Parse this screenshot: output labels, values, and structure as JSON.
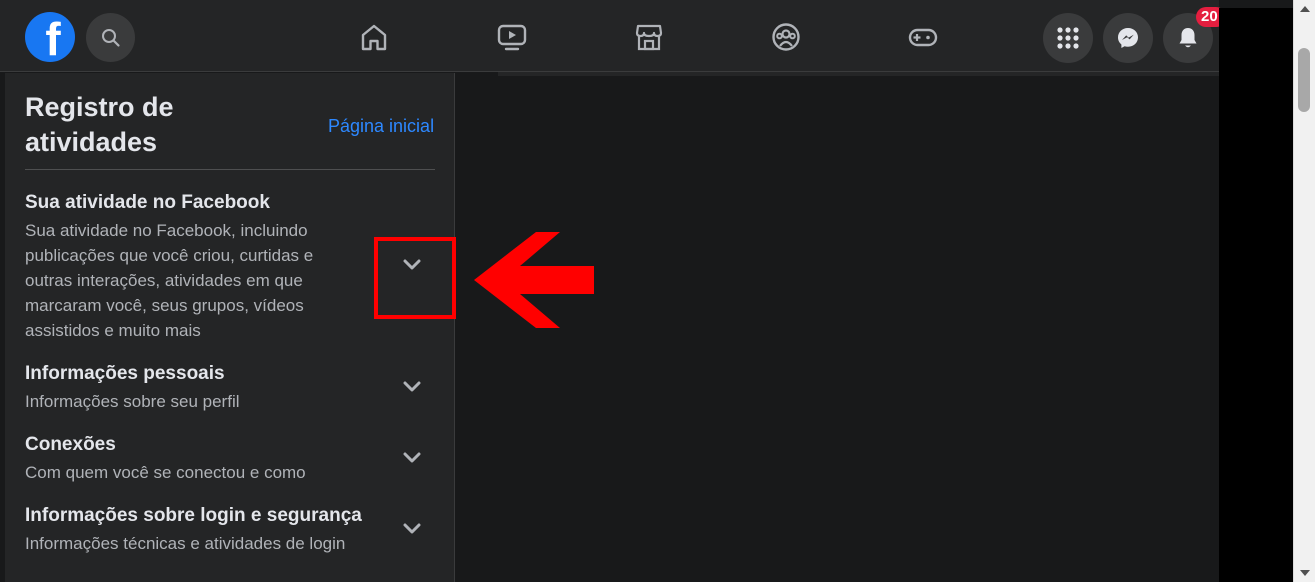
{
  "topbar": {
    "logo_letter": "f",
    "notification_count": "20",
    "icons": {
      "search": "search-icon",
      "home": "home-icon",
      "watch": "video-icon",
      "marketplace": "marketplace-icon",
      "groups": "groups-icon",
      "gaming": "gaming-icon",
      "menu": "grid-menu-icon",
      "messenger": "messenger-icon",
      "notifications": "bell-icon"
    }
  },
  "sidebar": {
    "title": "Registro de atividades",
    "home_link": "Página inicial",
    "items": [
      {
        "heading": "Sua atividade no Facebook",
        "description": "Sua atividade no Facebook, incluindo publicações que você criou, curtidas e outras interações, atividades em que marcaram você, seus grupos, vídeos assistidos e muito mais"
      },
      {
        "heading": "Informações pessoais",
        "description": "Informações sobre seu perfil"
      },
      {
        "heading": "Conexões",
        "description": "Com quem você se conectou e como"
      },
      {
        "heading": "Informações sobre login e segurança",
        "description": "Informações técnicas e atividades de login"
      }
    ]
  },
  "colors": {
    "brand": "#1877f2",
    "link": "#2d88ff",
    "badge": "#e41e3f",
    "annotation": "#ff0000",
    "panel": "#242526",
    "background": "#18191a"
  }
}
